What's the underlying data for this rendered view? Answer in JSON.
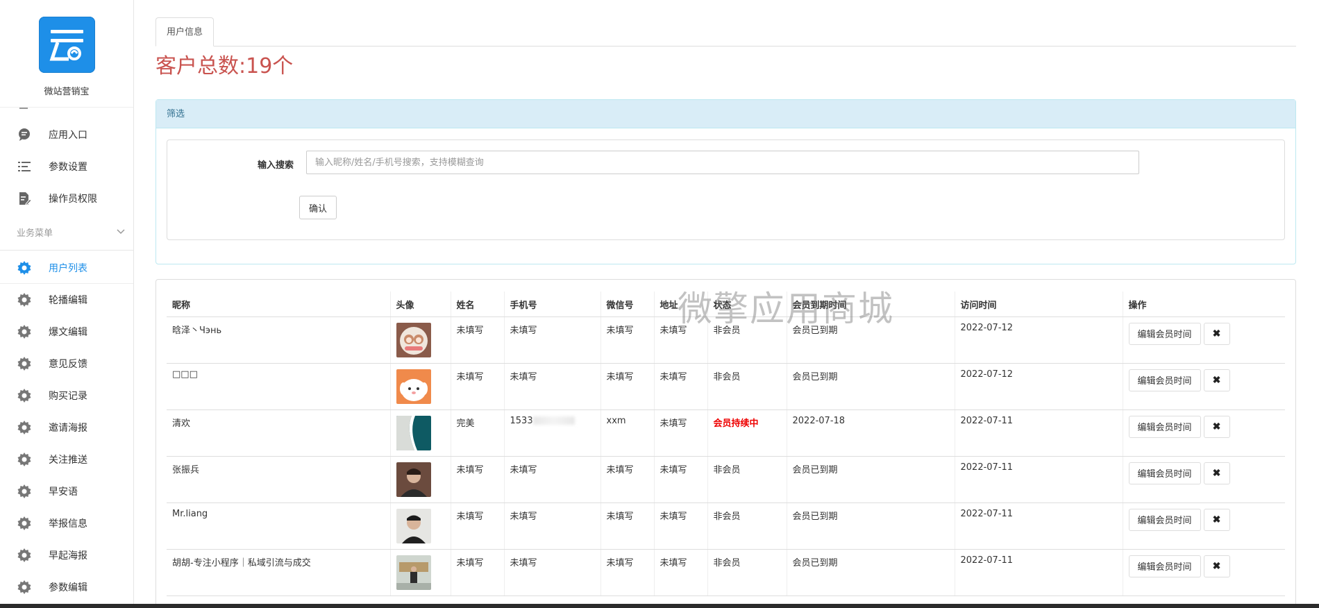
{
  "brand": {
    "name": "微站营销宝"
  },
  "sidebar": {
    "items": [
      {
        "label": "应用入口",
        "icon": "chat-bubble-icon"
      },
      {
        "label": "参数设置",
        "icon": "list-settings-icon"
      },
      {
        "label": "操作员权限",
        "icon": "edit-document-icon"
      }
    ],
    "section_title": "业务菜单",
    "business_items": [
      {
        "label": "用户列表",
        "active": true
      },
      {
        "label": "轮播编辑"
      },
      {
        "label": "爆文编辑"
      },
      {
        "label": "意见反馈"
      },
      {
        "label": "购买记录"
      },
      {
        "label": "邀请海报"
      },
      {
        "label": "关注推送"
      },
      {
        "label": "早安语"
      },
      {
        "label": "举报信息"
      },
      {
        "label": "早起海报"
      },
      {
        "label": "参数编辑"
      }
    ]
  },
  "tabs": {
    "active": "用户信息"
  },
  "summary": {
    "total": "客户总数:19个"
  },
  "filter": {
    "title": "筛选",
    "search_label": "输入搜索",
    "search_placeholder": "输入昵称/姓名/手机号搜索，支持模糊查询",
    "confirm_label": "确认"
  },
  "table": {
    "headers": [
      "昵称",
      "头像",
      "姓名",
      "手机号",
      "微信号",
      "地址",
      "状态",
      "会员到期时间",
      "访问时间",
      "操作"
    ],
    "edit_label": "编辑会员时间",
    "delete_label": "✖",
    "rows": [
      {
        "nickname": "晗泽丶Чэнь",
        "name": "未填写",
        "phone": "未填写",
        "wechat": "未填写",
        "address": "未填写",
        "status": "非会员",
        "expire": "会员已到期",
        "visit": "2022-07-12"
      },
      {
        "nickname": "□□□",
        "name": "未填写",
        "phone": "未填写",
        "wechat": "未填写",
        "address": "未填写",
        "status": "非会员",
        "expire": "会员已到期",
        "visit": "2022-07-12"
      },
      {
        "nickname": "清欢",
        "name": "完美",
        "phone": "1533",
        "wechat": "xxm",
        "address": "未填写",
        "status": "会员持续中",
        "expire": "2022-07-18",
        "visit": "2022-07-11"
      },
      {
        "nickname": "张振兵",
        "name": "未填写",
        "phone": "未填写",
        "wechat": "未填写",
        "address": "未填写",
        "status": "非会员",
        "expire": "会员已到期",
        "visit": "2022-07-11"
      },
      {
        "nickname": "Mr.liang",
        "name": "未填写",
        "phone": "未填写",
        "wechat": "未填写",
        "address": "未填写",
        "status": "非会员",
        "expire": "会员已到期",
        "visit": "2022-07-11"
      },
      {
        "nickname": "胡胡-专注小程序｜私域引流与成交",
        "name": "未填写",
        "phone": "未填写",
        "wechat": "未填写",
        "address": "未填写",
        "status": "非会员",
        "expire": "会员已到期",
        "visit": "2022-07-11"
      }
    ]
  },
  "watermark": "微擎应用商城",
  "colors": {
    "accent": "#1e8fe8",
    "total_red": "#c9534f",
    "status_red": "#ee0000",
    "filter_head_bg": "#d9edf7"
  }
}
